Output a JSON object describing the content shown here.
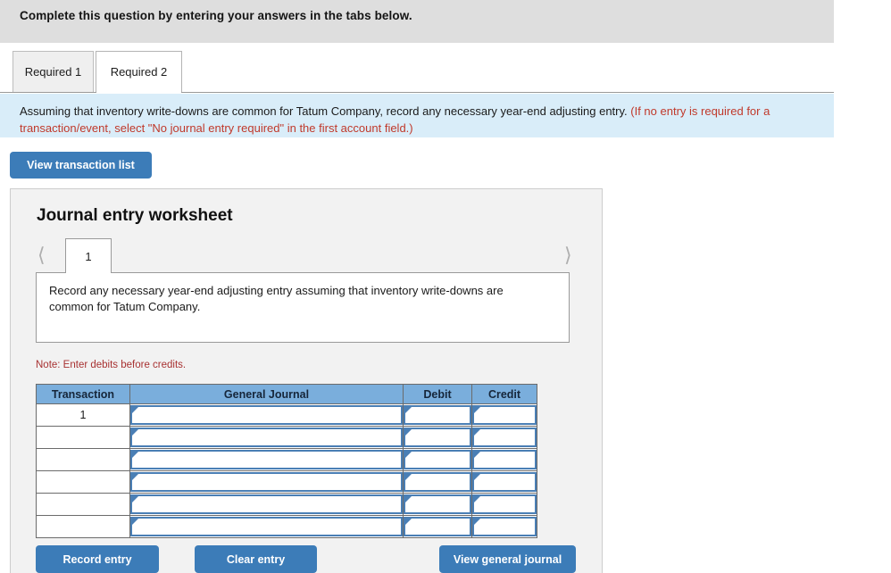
{
  "header": {
    "instruction": "Complete this question by entering your answers in the tabs below."
  },
  "tabs": [
    {
      "label": "Required 1",
      "active": false
    },
    {
      "label": "Required 2",
      "active": true
    }
  ],
  "banner": {
    "main_text": "Assuming that inventory write-downs are common for Tatum Company, record any necessary year-end adjusting entry. ",
    "hint_text": "(If no entry is required for a transaction/event, select \"No journal entry required\" in the first account field.)"
  },
  "toolbar": {
    "view_transaction_list_label": "View transaction list"
  },
  "worksheet": {
    "title": "Journal entry worksheet",
    "pager": {
      "prev_icon": "chevron-left-icon",
      "next_icon": "chevron-right-icon",
      "current_page": "1"
    },
    "description": "Record any necessary year-end adjusting entry assuming that inventory write-downs are common for Tatum Company.",
    "note": "Note: Enter debits before credits.",
    "table": {
      "columns": [
        "Transaction",
        "General Journal",
        "Debit",
        "Credit"
      ],
      "rows": [
        {
          "transaction": "1",
          "general_journal": "",
          "debit": "",
          "credit": ""
        },
        {
          "transaction": "",
          "general_journal": "",
          "debit": "",
          "credit": ""
        },
        {
          "transaction": "",
          "general_journal": "",
          "debit": "",
          "credit": ""
        },
        {
          "transaction": "",
          "general_journal": "",
          "debit": "",
          "credit": ""
        },
        {
          "transaction": "",
          "general_journal": "",
          "debit": "",
          "credit": ""
        },
        {
          "transaction": "",
          "general_journal": "",
          "debit": "",
          "credit": ""
        }
      ]
    },
    "actions": {
      "record_entry_label": "Record entry",
      "clear_entry_label": "Clear entry",
      "view_general_journal_label": "View general journal"
    }
  },
  "colors": {
    "primary_button": "#3c7cb8",
    "table_header": "#7aaedc",
    "banner_background": "#d9edf9",
    "hint_red": "#c0392b",
    "note_red": "#a83232"
  }
}
